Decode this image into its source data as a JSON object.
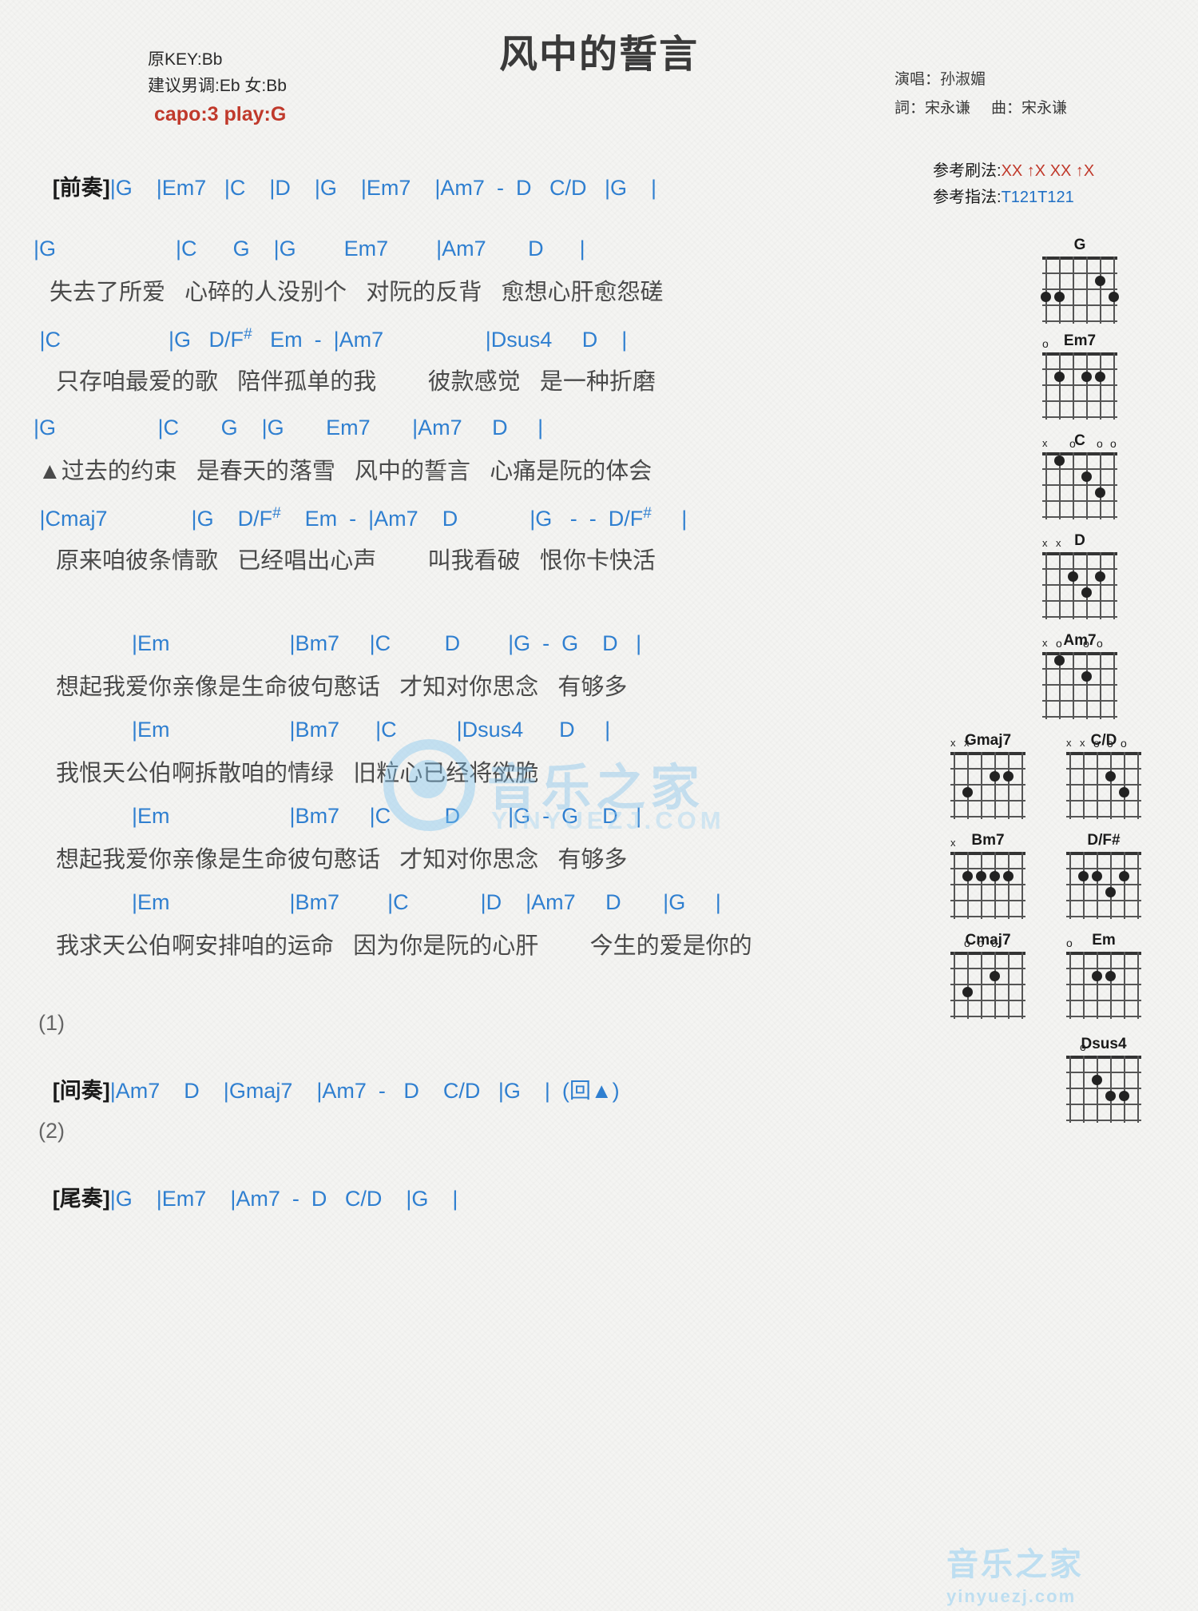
{
  "header": {
    "title": "风中的誓言",
    "original_key": "原KEY:Bb",
    "suggested_key": "建议男调:Eb 女:Bb",
    "capo": "capo:3 play:G",
    "singer_label": "演唱：孙淑媚",
    "lyricist_label": "詞：宋永谦",
    "composer_label": "曲：宋永谦"
  },
  "reference": {
    "strum_label": "参考刷法:",
    "strum_value": "XX ↑X XX ↑X",
    "finger_label": "参考指法:",
    "finger_value": "T121T121"
  },
  "sections": {
    "intro_tag": "[前奏]",
    "intro_chords": "|G    |Em7   |C    |D    |G    |Em7    |Am7  -  D   C/D   |G    |",
    "interlude_number": "(1)",
    "interlude_tag": "[间奏]",
    "interlude_chords": "|Am7    D    |Gmaj7    |Am7  -   D    C/D   |G    |  (回▲)",
    "outro_number": "(2)",
    "outro_tag": "[尾奏]",
    "outro_chords": "|G    |Em7    |Am7  -  D   C/D    |G    |"
  },
  "verses": [
    {
      "chords": "|G                    |C      G    |G        Em7        |Am7       D      |",
      "lyrics": "失去了所爱   心碎的人没别个   对阮的反背   愈想心肝愈怨磋"
    },
    {
      "chords": " |C                  |G   D/F#   Em  -  |Am7                 |Dsus4     D    |",
      "lyrics": " 只存咱最爱的歌   陪伴孤单的我        彼款感觉   是一种折磨"
    },
    {
      "chords": "|G                 |C       G    |G       Em7       |Am7     D     |",
      "lyrics": "▲过去的约束   是春天的落雪   风中的誓言   心痛是阮的体会"
    },
    {
      "chords": " |Cmaj7              |G    D/F#    Em  -  |Am7    D            |G   -  -  D/F#     |",
      "lyrics": " 原来咱彼条情歌   已经唱出心声        叫我看破   恨你卡快活"
    }
  ],
  "bridge": [
    {
      "chords": "  |Em                    |Bm7     |C         D        |G  -  G    D   |",
      "lyrics": " 想起我爱你亲像是生命彼句憨话   才知对你思念   有够多"
    },
    {
      "chords": "  |Em                    |Bm7      |C          |Dsus4      D     |",
      "lyrics": " 我恨天公伯啊拆散咱的情绿   旧粒心已经将欲脆"
    },
    {
      "chords": "  |Em                    |Bm7     |C         D        |G  -  G    D   |",
      "lyrics": " 想起我爱你亲像是生命彼句憨话   才知对你思念   有够多"
    },
    {
      "chords": "  |Em                    |Bm7        |C            |D    |Am7     D       |G     |",
      "lyrics": " 我求天公伯啊安排咱的运命   因为你是阮的心肝        今生的爱是你的"
    }
  ],
  "chord_diagrams": [
    {
      "name": "G",
      "markers": [
        "",
        "",
        "",
        "",
        "",
        ""
      ],
      "dots": [
        [
          3,
          5
        ],
        [
          2,
          4
        ],
        [
          3,
          0
        ],
        [
          3,
          1
        ]
      ]
    },
    {
      "name": "Em7",
      "markers": [
        "o",
        "",
        "",
        "",
        "",
        ""
      ],
      "dots": [
        [
          2,
          4
        ],
        [
          2,
          3
        ],
        [
          2,
          1
        ]
      ]
    },
    {
      "name": "C",
      "markers": [
        "x",
        "",
        "o",
        "",
        "o",
        "o"
      ],
      "dots": [
        [
          3,
          4
        ],
        [
          2,
          3
        ],
        [
          1,
          1
        ]
      ]
    },
    {
      "name": "D",
      "markers": [
        "x",
        "x",
        "",
        "",
        "",
        ""
      ],
      "dots": [
        [
          2,
          2
        ],
        [
          3,
          3
        ],
        [
          2,
          4
        ]
      ]
    },
    {
      "name": "Am7",
      "markers": [
        "x",
        "o",
        "",
        "o",
        "o",
        ""
      ],
      "dots": [
        [
          2,
          3
        ],
        [
          1,
          1
        ]
      ]
    },
    {
      "name": "Gmaj7",
      "markers": [
        "x",
        "x",
        "",
        "",
        "",
        ""
      ],
      "dots": [
        [
          3,
          1
        ],
        [
          2,
          3
        ],
        [
          2,
          4
        ]
      ]
    },
    {
      "name": "C/D",
      "markers": [
        "x",
        "x",
        "o",
        "o",
        "o",
        ""
      ],
      "dots": [
        [
          2,
          3
        ],
        [
          3,
          4
        ]
      ]
    },
    {
      "name": "Bm7",
      "markers": [
        "x",
        "",
        "",
        "",
        "",
        ""
      ],
      "dots": [
        [
          2,
          1
        ],
        [
          2,
          2
        ],
        [
          2,
          3
        ],
        [
          2,
          4
        ]
      ]
    },
    {
      "name": "D/F#",
      "markers": [
        "",
        "",
        "",
        "",
        "",
        ""
      ],
      "dots": [
        [
          2,
          1
        ],
        [
          2,
          2
        ],
        [
          3,
          3
        ],
        [
          2,
          4
        ]
      ]
    },
    {
      "name": "Cmaj7",
      "markers": [
        "",
        "o",
        "o",
        "o",
        "",
        ""
      ],
      "dots": [
        [
          3,
          1
        ],
        [
          2,
          3
        ]
      ]
    },
    {
      "name": "Em",
      "markers": [
        "o",
        "",
        "",
        "",
        "",
        ""
      ],
      "dots": [
        [
          2,
          2
        ],
        [
          2,
          3
        ]
      ]
    },
    {
      "name": "Dsus4",
      "markers": [
        "",
        "o",
        "",
        "",
        "",
        ""
      ],
      "dots": [
        [
          2,
          2
        ],
        [
          3,
          3
        ],
        [
          3,
          4
        ]
      ]
    }
  ],
  "watermark": {
    "center_text": "音乐之家",
    "center_sub": "YINYUEZJ.COM",
    "bottom_text": "音乐之家",
    "bottom_sub": "yinyuezj.com"
  }
}
